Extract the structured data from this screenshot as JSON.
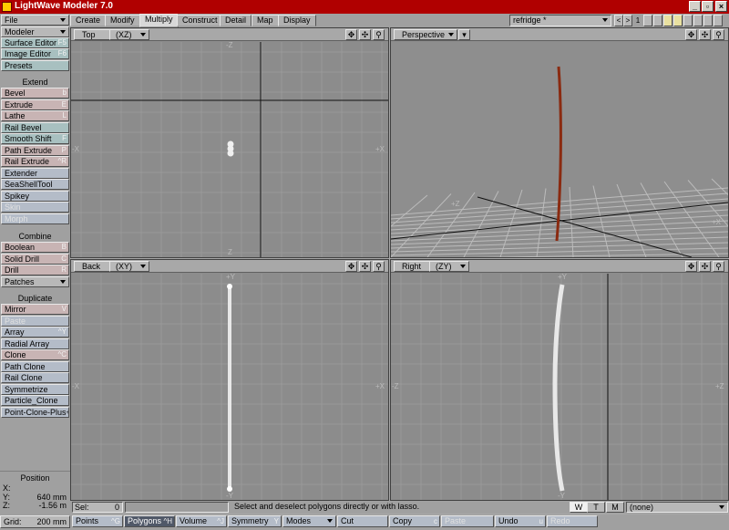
{
  "window": {
    "title": "LightWave Modeler 7.0",
    "controls": [
      "_",
      "▫",
      "×"
    ]
  },
  "left_panel": {
    "top_items": [
      {
        "label": "File",
        "dropdown": true
      },
      {
        "label": "Modeler",
        "dropdown": true
      },
      {
        "label": "Surface Editor",
        "key": "F5"
      },
      {
        "label": "Image Editor",
        "key": "F6"
      },
      {
        "label": "Presets",
        "key": ""
      }
    ],
    "sections": [
      {
        "heading": "Extend",
        "items": [
          {
            "label": "Bevel",
            "key": "b"
          },
          {
            "label": "Extrude",
            "key": "E"
          },
          {
            "label": "Lathe",
            "key": "L"
          },
          {
            "label": "Rail Bevel",
            "key": ""
          },
          {
            "label": "Smooth Shift",
            "key": "F"
          },
          {
            "label": "Path Extrude",
            "key": "P"
          },
          {
            "label": "Rail Extrude",
            "key": "^R"
          },
          {
            "label": "Extender",
            "key": ""
          },
          {
            "label": "SeaShellTool",
            "key": ""
          },
          {
            "label": "Spikey",
            "key": ""
          },
          {
            "label": "Skin",
            "key": "",
            "disabled": true
          },
          {
            "label": "Morph",
            "key": "",
            "disabled": true
          }
        ]
      },
      {
        "heading": "Combine",
        "items": [
          {
            "label": "Boolean",
            "key": "B"
          },
          {
            "label": "Solid Drill",
            "key": "C"
          },
          {
            "label": "Drill",
            "key": "R"
          },
          {
            "label": "Patches",
            "key": "",
            "dropdown": true
          }
        ]
      },
      {
        "heading": "Duplicate",
        "items": [
          {
            "label": "Mirror",
            "key": "V"
          },
          {
            "label": "Paste",
            "key": "",
            "disabled": true
          },
          {
            "label": "Array",
            "key": "^Y"
          },
          {
            "label": "Radial Array",
            "key": ""
          },
          {
            "label": "Clone",
            "key": "^C"
          },
          {
            "label": "Path Clone",
            "key": ""
          },
          {
            "label": "Rail Clone",
            "key": ""
          },
          {
            "label": "Symmetrize",
            "key": ""
          },
          {
            "label": "Particle_Clone",
            "key": ""
          },
          {
            "label": "Point-Clone-Plus+",
            "key": ""
          }
        ]
      }
    ],
    "position": {
      "title": "Position",
      "x_label": "X:",
      "x_value": "",
      "y_label": "Y:",
      "y_value": "640 mm",
      "z_label": "Z:",
      "z_value": "-1.56 m"
    },
    "grid": {
      "label": "Grid:",
      "value": "200 mm"
    }
  },
  "tabs": [
    "Create",
    "Modify",
    "Multiply",
    "Construct",
    "Detail",
    "Map",
    "Display"
  ],
  "active_tab": "Multiply",
  "scene_select": "refridge *",
  "layer_number": "1",
  "viewports": [
    {
      "name": "Top",
      "axes": "(XZ)",
      "top_label": "-Z",
      "bottom_label": "Z",
      "left_label": "-X",
      "right_label": "+X"
    },
    {
      "name": "Perspective",
      "axes": ""
    },
    {
      "name": "Back",
      "axes": "(XY)",
      "top_label": "+Y",
      "bottom_label": "-Y",
      "left_label": "-X",
      "right_label": "+X"
    },
    {
      "name": "Right",
      "axes": "(ZY)",
      "top_label": "+Y",
      "bottom_label": "-Y",
      "left_label": "-Z",
      "right_label": "+Z"
    }
  ],
  "perspective_labels": {
    "z": "+Z",
    "x": "+X"
  },
  "statusbar": {
    "sel_label": "Sel:",
    "sel_value": "0",
    "hint": "Select and deselect polygons directly or with lasso.",
    "wtm": [
      "W",
      "T",
      "M"
    ],
    "layer_select": "(none)"
  },
  "modebar": [
    {
      "label": "Points",
      "key": "^G"
    },
    {
      "label": "Polygons",
      "key": "^H",
      "active": true
    },
    {
      "label": "Volume",
      "key": "^J"
    },
    {
      "label": "Symmetry",
      "key": "Y"
    },
    {
      "label": "Modes",
      "key": "",
      "dropdown": true
    },
    {
      "label": "Cut",
      "key": ""
    },
    {
      "label": "Copy",
      "key": "c"
    },
    {
      "label": "Paste",
      "key": "",
      "disabled": true
    },
    {
      "label": "Undo",
      "key": "u"
    },
    {
      "label": "Redo",
      "key": "",
      "disabled": true
    }
  ],
  "colors": {
    "titlebar": "#b00000",
    "object_perspective": "#8a2a10",
    "object_wire": "#ffffff"
  }
}
